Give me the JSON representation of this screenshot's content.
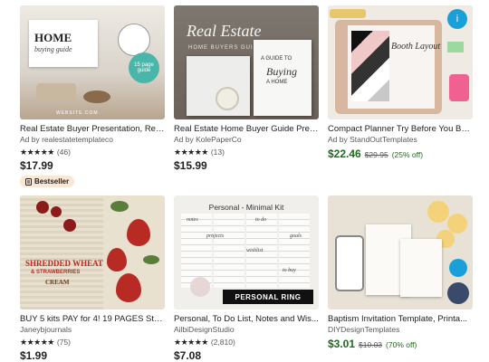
{
  "listings": [
    {
      "title": "Real Estate Buyer Presentation, Real...",
      "shop": "Ad by realestatetemplateco",
      "stars": "★★★★★",
      "count": "(46)",
      "price": "$17.99",
      "badge": "Bestseller",
      "thumb": {
        "heading": "HOME",
        "subheading": "buying guide",
        "sticker": "15 page guide",
        "footer": "WEBSITE.COM"
      }
    },
    {
      "title": "Real Estate Home Buyer Guide Pres...",
      "shop": "Ad by KolePaperCo",
      "stars": "★★★★★",
      "count": "(13)",
      "price": "$15.99",
      "thumb": {
        "heading": "Real Estate",
        "subheading": "HOME BUYERS GUIDE",
        "book_a": "A GUIDE TO",
        "book_b": "Buying",
        "book_c": "A HOME"
      }
    },
    {
      "title": "Compact Planner Try Before You Bu...",
      "shop": "Ad by StandOutTemplates",
      "price": "$22.46",
      "original": "$29.95",
      "discount": "(25% off)",
      "thumb": {
        "label": "Booth Layout",
        "badge_icon": "i"
      }
    },
    {
      "title": "BUY 5 kits PAY for 4! 19 PAGES Stra...",
      "shop": "Janeybjournals",
      "stars": "★★★★★",
      "count": "(75)",
      "price": "$1.99",
      "thumb": {
        "line1": "SHREDDED WHEAT",
        "line2": "& STRAWBERRIES",
        "line3": "CREAM"
      }
    },
    {
      "title": "Personal, To Do List, Notes and Wis...",
      "shop": "AilbiDesignStudio",
      "stars": "★★★★★",
      "count": "(2,810)",
      "price": "$7.08",
      "thumb": {
        "header": "Personal - Minimal Kit",
        "notes": "notes",
        "todo": "to do",
        "projects": "projects",
        "goals": "goals",
        "wishlist": "wishlist",
        "tobuy": "to buy",
        "ring": "PERSONAL RING"
      }
    },
    {
      "title": "Baptism Invitation Template, Printa...",
      "shop": "DIYDesignTemplates",
      "price": "$3.01",
      "original": "$10.03",
      "discount": "(70% off)"
    }
  ],
  "icons": {
    "badge": "bestseller-icon"
  },
  "colors": {
    "sale": "#1a6b1a",
    "badge_bg": "#fbe7d3",
    "text": "#222222",
    "muted": "#595959"
  }
}
